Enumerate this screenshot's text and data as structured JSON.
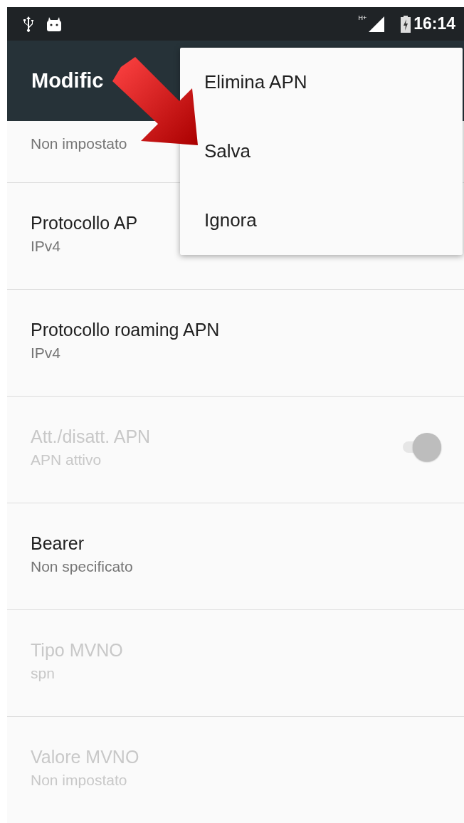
{
  "status_bar": {
    "network": "H+",
    "time": "16:14"
  },
  "toolbar": {
    "title": "Modific"
  },
  "rows": [
    {
      "kind": "text",
      "title": "",
      "subtitle": "Non impostato",
      "disabled": false
    },
    {
      "kind": "text",
      "title": "Protocollo AP",
      "subtitle": "IPv4",
      "disabled": false
    },
    {
      "kind": "text",
      "title": "Protocollo roaming APN",
      "subtitle": "IPv4",
      "disabled": false
    },
    {
      "kind": "switch",
      "title": "Att./disatt. APN",
      "subtitle": "APN attivo",
      "disabled": true,
      "on": true
    },
    {
      "kind": "text",
      "title": "Bearer",
      "subtitle": "Non specificato",
      "disabled": false
    },
    {
      "kind": "text",
      "title": "Tipo MVNO",
      "subtitle": "spn",
      "disabled": true
    },
    {
      "kind": "text",
      "title": "Valore MVNO",
      "subtitle": "Non impostato",
      "disabled": true
    }
  ],
  "menu": {
    "items": [
      "Elimina APN",
      "Salva",
      "Ignora"
    ]
  }
}
